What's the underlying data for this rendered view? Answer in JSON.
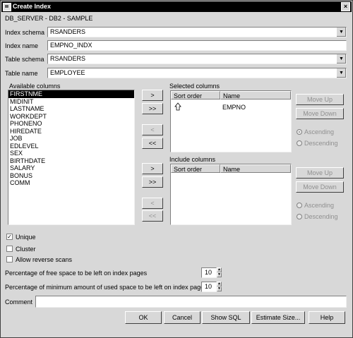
{
  "window": {
    "title": "Create Index",
    "close_label": "×"
  },
  "breadcrumb": "DB_SERVER - DB2 - SAMPLE",
  "fields": {
    "index_schema": {
      "label": "Index schema",
      "value": "RSANDERS"
    },
    "index_name": {
      "label": "Index name",
      "value": "EMPNO_INDX"
    },
    "table_schema": {
      "label": "Table schema",
      "value": "RSANDERS"
    },
    "table_name": {
      "label": "Table name",
      "value": "EMPLOYEE"
    }
  },
  "available_columns": {
    "label": "Available columns",
    "items": [
      "FIRSTNME",
      "MIDINIT",
      "LASTNAME",
      "WORKDEPT",
      "PHONENO",
      "HIREDATE",
      "JOB",
      "EDLEVEL",
      "SEX",
      "BIRTHDATE",
      "SALARY",
      "BONUS",
      "COMM"
    ]
  },
  "transfer_buttons": {
    "add": ">",
    "add_all": ">>",
    "remove": "<",
    "remove_all": "<<"
  },
  "selected_columns": {
    "label": "Selected columns",
    "headers": {
      "sort_order": "Sort order",
      "name": "Name"
    },
    "rows": [
      {
        "icon": "up-arrow-icon",
        "name": "EMPNO"
      }
    ]
  },
  "include_columns": {
    "label": "Include columns",
    "headers": {
      "sort_order": "Sort order",
      "name": "Name"
    }
  },
  "order_controls": {
    "move_up": "Move Up",
    "move_down": "Move Down",
    "ascending": "Ascending",
    "descending": "Descending"
  },
  "options": {
    "unique": {
      "label": "Unique",
      "checked": true
    },
    "cluster": {
      "label": "Cluster",
      "checked": false
    },
    "allow_reverse_scans": {
      "label": "Allow reverse scans",
      "checked": false
    }
  },
  "space": {
    "free_label": "Percentage of free space to be left on index pages",
    "free_value": "10",
    "min_used_label": "Percentage of minimum amount of used space to be left on index pages",
    "min_used_value": "10"
  },
  "comment": {
    "label": "Comment",
    "value": ""
  },
  "footer": {
    "ok": "OK",
    "cancel": "Cancel",
    "show_sql": "Show SQL",
    "estimate_size": "Estimate Size...",
    "help": "Help"
  }
}
